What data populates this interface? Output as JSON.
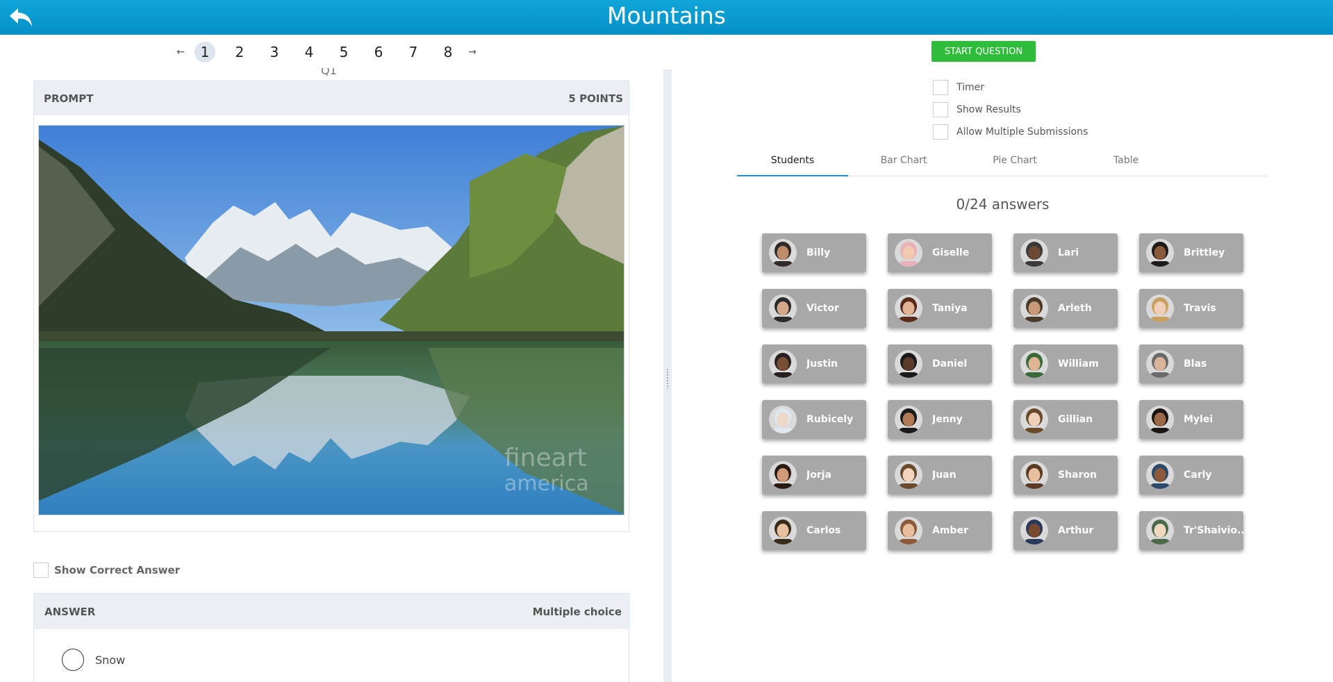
{
  "header": {
    "title": "Mountains",
    "back_icon": "back-arrow-icon"
  },
  "pager": {
    "prev": "←",
    "next": "→",
    "pages": [
      "1",
      "2",
      "3",
      "4",
      "5",
      "6",
      "7",
      "8"
    ],
    "current": "1"
  },
  "question": {
    "stub": "Q1"
  },
  "prompt": {
    "label": "PROMPT",
    "points": "5 POINTS",
    "watermark_line1": "fineart",
    "watermark_line2": "america"
  },
  "show_correct": {
    "label": "Show Correct Answer",
    "checked": false
  },
  "answer": {
    "label": "ANSWER",
    "type": "Multiple choice",
    "options": [
      "Snow"
    ]
  },
  "controls": {
    "start_label": "START QUESTION",
    "start_color": "#2ebd3a",
    "options": [
      {
        "label": "Timer",
        "checked": false
      },
      {
        "label": "Show Results",
        "checked": false
      },
      {
        "label": "Allow Multiple Submissions",
        "checked": false
      }
    ]
  },
  "tabs": [
    "Students",
    "Bar Chart",
    "Pie Chart",
    "Table"
  ],
  "active_tab": "Students",
  "answers_count": "0/24 answers",
  "students": [
    {
      "name": "Billy"
    },
    {
      "name": "Giselle"
    },
    {
      "name": "Lari"
    },
    {
      "name": "Brittley"
    },
    {
      "name": "Victor"
    },
    {
      "name": "Taniya"
    },
    {
      "name": "Arleth"
    },
    {
      "name": "Travis"
    },
    {
      "name": "Justin"
    },
    {
      "name": "Daniel"
    },
    {
      "name": "William"
    },
    {
      "name": "Blas"
    },
    {
      "name": "Rubicely"
    },
    {
      "name": "Jenny"
    },
    {
      "name": "Gillian"
    },
    {
      "name": "Mylei"
    },
    {
      "name": "Jorja"
    },
    {
      "name": "Juan"
    },
    {
      "name": "Sharon"
    },
    {
      "name": "Carly"
    },
    {
      "name": "Carlos"
    },
    {
      "name": "Amber"
    },
    {
      "name": "Arthur"
    },
    {
      "name": "Tr'Shaivio.."
    }
  ],
  "colors": {
    "header": "#0a9bd2",
    "tab_underline": "#1e8fcf",
    "student_tile": "#a8a8a8"
  }
}
